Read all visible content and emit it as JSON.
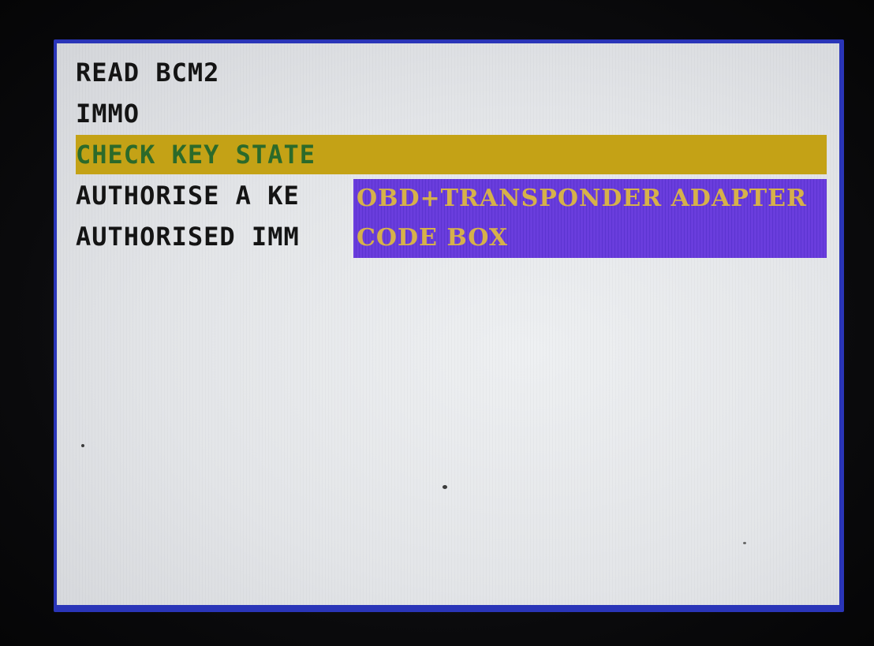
{
  "menu": {
    "items": [
      {
        "label": "READ BCM2"
      },
      {
        "label": "IMMO"
      },
      {
        "label": "CHECK KEY STATE"
      },
      {
        "label": "AUTHORISE A KE"
      },
      {
        "label": "AUTHORISED IMM"
      }
    ],
    "selected_index": 2
  },
  "popup": {
    "options": [
      {
        "label": "OBD+TRANSPONDER ADAPTER"
      },
      {
        "label": "CODE BOX"
      }
    ]
  },
  "colors": {
    "frame": "#2a35b8",
    "screen": "#e6e8eb",
    "highlight": "#c4a216",
    "selected_text": "#2c6a2a",
    "popup_bg": "#6a3ddd",
    "popup_text": "#d6b14a"
  }
}
